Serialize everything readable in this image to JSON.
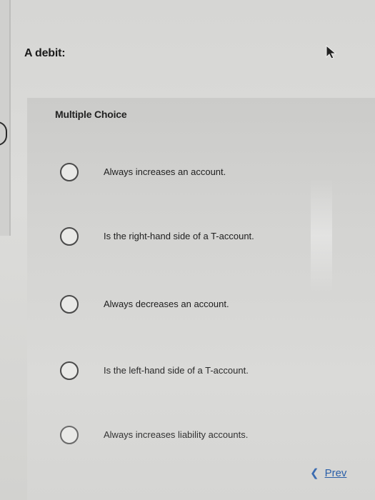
{
  "question": "A debit:",
  "panel_label": "Multiple Choice",
  "options": [
    {
      "label": "Always increases an account."
    },
    {
      "label": "Is the right-hand side of a T-account."
    },
    {
      "label": "Always decreases an account."
    },
    {
      "label": "Is the left-hand side of a T-account."
    },
    {
      "label": "Always increases liability accounts."
    }
  ],
  "nav": {
    "prev_label": "Prev",
    "prev_icon": "chevron-left-icon"
  },
  "colors": {
    "link": "#2a5fa8",
    "panel": "#d3d3d1",
    "background": "#d8d8d6"
  }
}
